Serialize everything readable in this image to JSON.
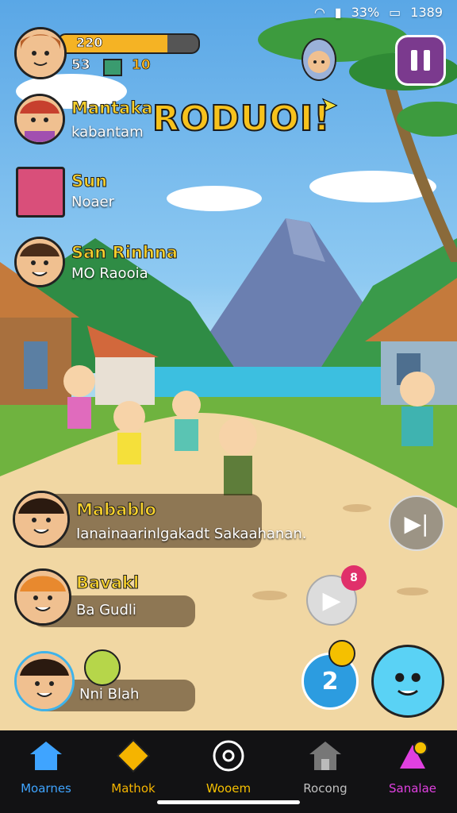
{
  "status_bar": {
    "battery": "33%",
    "time": "1389"
  },
  "player": {
    "xp_value": "220",
    "xp_progress": 0.78,
    "currency_a": "53",
    "currency_b": "10"
  },
  "title": {
    "name": "Mantaka",
    "subtitle": "kabantam",
    "banner": "RODUOI!"
  },
  "quest_items": [
    {
      "name": "Sun",
      "subtitle": "Noaer"
    },
    {
      "name": "San Rinhna",
      "subtitle": "MO Raooia"
    }
  ],
  "chat": [
    {
      "name": "Mabablo",
      "message": "Ianainaarinlgakadt Sakaahanan."
    },
    {
      "name": "Bavakl",
      "message": "Ba Gudli"
    },
    {
      "name": "",
      "message": "Nni Blah"
    }
  ],
  "notification_badge": "8",
  "nav": [
    {
      "label": "Moarnes",
      "icon": "home-icon",
      "color": "#3fa4ff"
    },
    {
      "label": "Mathok",
      "icon": "map-icon",
      "color": "#f5b400"
    },
    {
      "label": "Wooem",
      "icon": "compass-icon",
      "color": "#f5c000"
    },
    {
      "label": "Rocong",
      "icon": "house-icon",
      "color": "#c0c0c0"
    },
    {
      "label": "Sanalae",
      "icon": "profile-icon",
      "color": "#e040e0"
    }
  ]
}
